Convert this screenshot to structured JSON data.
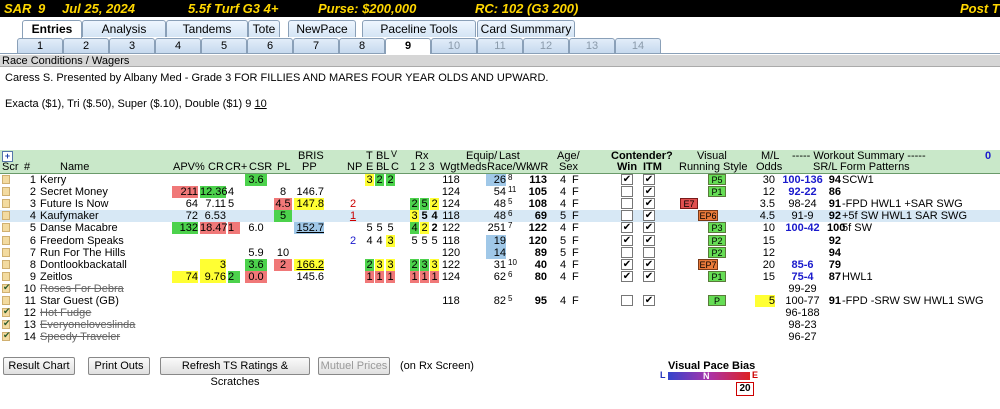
{
  "title_bar": {
    "track": "SAR",
    "race_no": "9",
    "date": "Jul 25, 2024",
    "race_type": "5.5f  Turf  G3  4+",
    "purse": "Purse: $200,000",
    "rc": "RC: 102  (G3 200)",
    "post": "Post T"
  },
  "tabs": [
    "Entries",
    "Analysis",
    "Tandems",
    "Tote",
    "NewPace",
    "Paceline Tools",
    "Card Summmary"
  ],
  "race_tabs": [
    "1",
    "2",
    "3",
    "4",
    "5",
    "6",
    "7",
    "8",
    "9",
    "10",
    "11",
    "12",
    "13",
    "14"
  ],
  "section_header": "Race Conditions / Wagers",
  "conditions": "Caress S. Presented by Albany Med - Grade 3 FOR FILLIES AND MARES FOUR YEAR OLDS AND UPWARD.",
  "wagers_text": "Exacta ($1), Tri ($.50), Super ($.10), Double ($1) 9 ",
  "wagers_link": "10",
  "columns": {
    "plus": "+",
    "scr": "Scr",
    "num": "#",
    "name": "Name",
    "apv": "APV%",
    "cr": "CR",
    "crplus": "CR+",
    "csr": "CSR",
    "pl": "PL",
    "bris": "BRIS",
    "pp": "PP",
    "np": "NP",
    "t": "T",
    "e": "E",
    "bl": "BL",
    "b": "B",
    "l": "L",
    "v": "V",
    "c": "C",
    "rx": "Rx",
    "rx123": "1  2  3",
    "wgt": "Wgt",
    "equip": "Equip/",
    "meds": "Meds",
    "last": "Last",
    "race_wk": "Race/Wk",
    "wr": "WR",
    "age": "Age/",
    "sex": "Sex",
    "contender": "Contender?",
    "win": "Win",
    "itm": "ITM",
    "visual": "Visual",
    "running_style": "Running Style",
    "ml": "M/L",
    "odds": "Odds",
    "workout_summary": "----- Workout Summary -----",
    "srl": "SR/L",
    "form_patterns": "Form Patterns",
    "zero": "0"
  },
  "entries": [
    {
      "num": "1",
      "name": "Kerry",
      "csr": "3.6",
      "t": "3",
      "e": "2",
      "bl": "2",
      "wgt": "118",
      "last": "26",
      "wk": "8",
      "wr": "113",
      "age": "4",
      "sex": "F",
      "win": "✔",
      "itm": "✔",
      "style": "P",
      "style_sup": "5",
      "ml": "30",
      "workout": "100-136",
      "srl": "94",
      "form": "SCW1"
    },
    {
      "num": "2",
      "name": "Secret Money",
      "apv": "211",
      "cr": "12.36",
      "crplus": "4",
      "pl": "8",
      "bris": "146.7",
      "wgt": "124",
      "last": "54",
      "wk": "11",
      "wr": "105",
      "age": "4",
      "sex": "F",
      "win": "",
      "itm": "✔",
      "style": "P",
      "style_sup": "1",
      "ml": "12",
      "workout": "92-22",
      "srl": "86",
      "form": ""
    },
    {
      "num": "3",
      "name": "Future Is Now",
      "apv": "64",
      "cr": "7.11",
      "crplus": "5",
      "pl": "4.5",
      "bris": "147.8",
      "np": "2",
      "rx1": "2",
      "rx2": "5",
      "rx3": "2",
      "wgt": "124",
      "last": "48",
      "wk": "5",
      "wr": "108",
      "age": "4",
      "sex": "F",
      "win": "",
      "itm": "✔",
      "style": "E",
      "style_sup": "7",
      "ml": "3.5",
      "workout": "98-24",
      "srl": "91",
      "form": "-FPD  HWL1  +SAR  SWG"
    },
    {
      "num": "4",
      "name": "Kaufymaker",
      "apv": "72",
      "cr": "6.53",
      "pl": "5",
      "np": "1",
      "rx1": "3",
      "rx2": "5",
      "rx3": "4",
      "wgt": "118",
      "last": "48",
      "wk": "6",
      "wr": "69",
      "age": "5",
      "sex": "F",
      "win": "",
      "itm": "✔",
      "style": "EP",
      "style_sup": "6",
      "ml": "4.5",
      "workout": "91-9",
      "srl": "92",
      "form": "+5f  SW  HWL1  SAR  SWG"
    },
    {
      "num": "5",
      "name": "Danse Macabre",
      "apv": "132",
      "cr": "18.47",
      "crplus": "1",
      "csr": "6.0",
      "bris": "152.7",
      "t": "5",
      "e": "5",
      "bl": "5",
      "rx1": "4",
      "rx2": "2",
      "rx3": "2",
      "wgt": "122",
      "last": "251",
      "wk": "7",
      "wr": "122",
      "age": "4",
      "sex": "F",
      "win": "✔",
      "itm": "✔",
      "style": "P",
      "style_sup": "3",
      "ml": "10",
      "workout": "100-42",
      "srl": "100",
      "form": "5f  SW"
    },
    {
      "num": "6",
      "name": "Freedom Speaks",
      "np": "2",
      "t": "4",
      "e": "4",
      "bl": "3",
      "rx1": "5",
      "rx2": "5",
      "rx3": "5",
      "wgt": "118",
      "last": "19",
      "wk": "",
      "wr": "120",
      "age": "5",
      "sex": "F",
      "win": "✔",
      "itm": "✔",
      "style": "P",
      "style_sup": "2",
      "ml": "15",
      "workout": "",
      "srl": "92",
      "form": ""
    },
    {
      "num": "7",
      "name": "Run For The Hills",
      "csr": "5.9",
      "pl": "10",
      "wgt": "120",
      "last": "14",
      "wk": "",
      "wr": "89",
      "age": "5",
      "sex": "F",
      "win": "",
      "itm": "",
      "style": "P",
      "style_sup": "2",
      "ml": "12",
      "workout": "",
      "srl": "94",
      "form": ""
    },
    {
      "num": "8",
      "name": "Dontlookbackatall",
      "cr": "3",
      "csr": "3.6",
      "pl": "2",
      "bris": "166.2",
      "t": "2",
      "e": "3",
      "bl": "3",
      "rx1": "2",
      "rx2": "3",
      "rx3": "3",
      "wgt": "122",
      "last": "31",
      "wk": "10",
      "wr": "40",
      "age": "4",
      "sex": "F",
      "win": "✔",
      "itm": "✔",
      "style": "EP",
      "style_sup": "7",
      "ml": "20",
      "workout": "85-6",
      "srl": "79",
      "form": ""
    },
    {
      "num": "9",
      "name": "Zeitlos",
      "apv": "74",
      "cr": "9.76",
      "crplus": "2",
      "csr": "0.0",
      "bris": "145.6",
      "t": "1",
      "e": "1",
      "bl": "1",
      "rx1": "1",
      "rx2": "1",
      "rx3": "1",
      "wgt": "124",
      "last": "62",
      "wk": "6",
      "wr": "80",
      "age": "4",
      "sex": "F",
      "win": "✔",
      "itm": "✔",
      "style": "P",
      "style_sup": "1",
      "ml": "15",
      "workout": "75-4",
      "srl": "87",
      "form": "HWL1"
    },
    {
      "num": "10",
      "name": "Roses For Debra",
      "scratched": true,
      "workout": "99-29"
    },
    {
      "num": "11",
      "name": "Star Guest (GB)",
      "wgt": "118",
      "last": "82",
      "wk": "5",
      "wr": "95",
      "age": "4",
      "sex": "F",
      "win": "",
      "itm": "✔",
      "style": "P",
      "style_sup": "",
      "ml": "5",
      "workout": "100-77",
      "srl": "91",
      "form": "-FPD  -SRW  SW  HWL1  SWG"
    },
    {
      "num": "12",
      "name": "Hot Fudge",
      "scratched": true,
      "workout": "96-188"
    },
    {
      "num": "13",
      "name": "Everyoneloveslinda",
      "scratched": true,
      "workout": "98-23"
    },
    {
      "num": "14",
      "name": "Speedy Traveler",
      "scratched": true,
      "workout": "96-27"
    }
  ],
  "buttons": {
    "result_chart": "Result Chart",
    "print_outs": "Print Outs",
    "refresh": "Refresh TS Ratings & Scratches",
    "mutuel": "Mutuel Prices",
    "rx_screen": "(on Rx Screen)"
  },
  "pace_bias": {
    "title": "Visual Pace Bias",
    "l": "L",
    "n": "N",
    "e": "E",
    "value": "20"
  },
  "colors": {
    "title_bg": "#000000",
    "title_fg": "#ffd700",
    "header_green": "#c9e8c9",
    "highlight_yellow": "#ffff33",
    "highlight_green": "#4cd24c",
    "highlight_red": "#f07878",
    "highlight_blue": "#a0c8e8"
  }
}
